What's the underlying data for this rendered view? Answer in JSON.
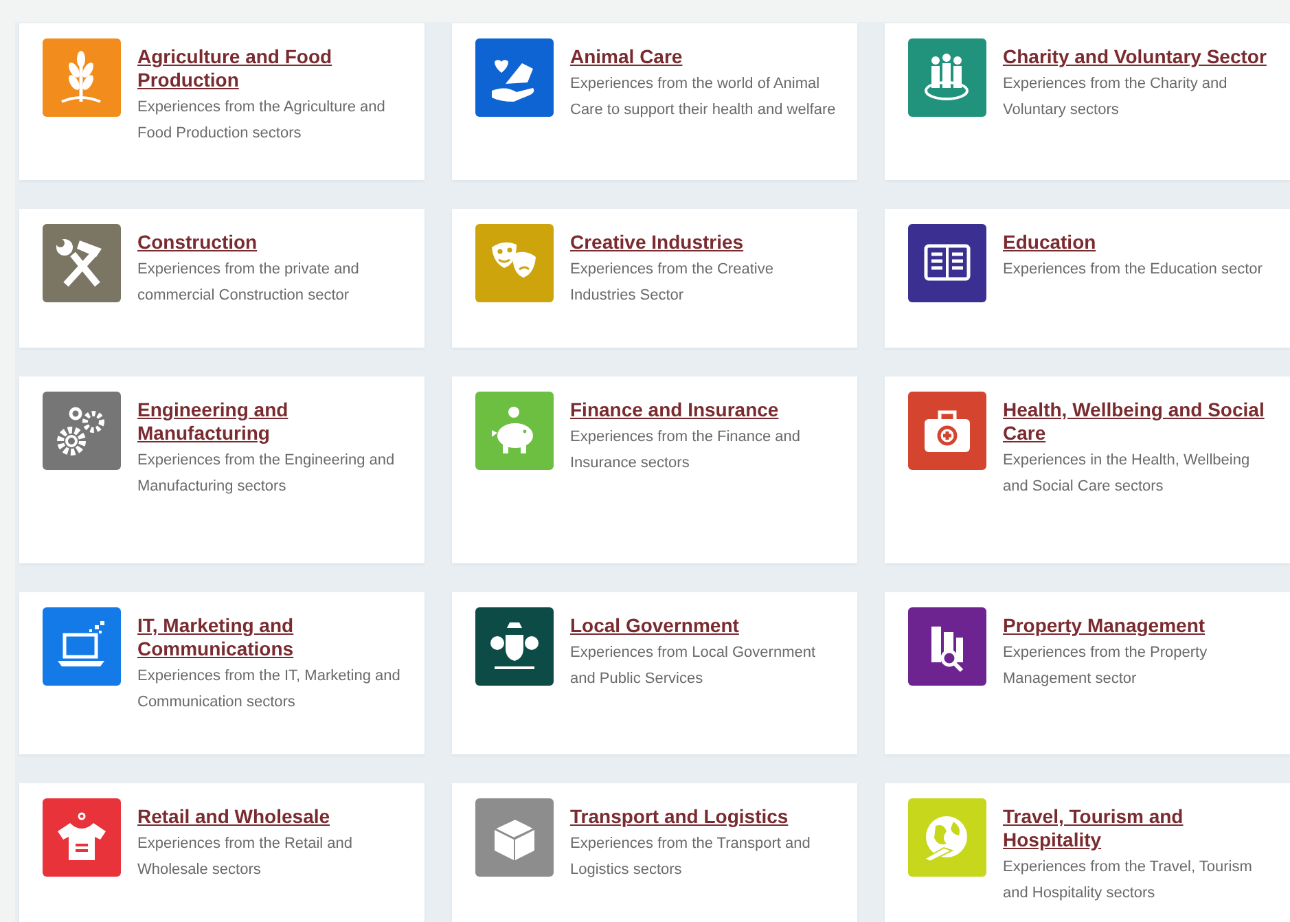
{
  "cards": [
    {
      "title": "Agriculture and Food Production",
      "description": "Experiences from the Agriculture and Food Production sectors",
      "color": "#f28c1c"
    },
    {
      "title": "Animal Care",
      "description": "Experiences from the world of Animal Care to support their health and welfare",
      "color": "#0e64d2"
    },
    {
      "title": "Charity and Voluntary Sector",
      "description": "Experiences from the Charity and Voluntary sectors",
      "color": "#21927c"
    },
    {
      "title": "Construction",
      "description": "Experiences from the private and commercial Construction sector",
      "color": "#7b7563"
    },
    {
      "title": "Creative Industries",
      "description": "Experiences from the Creative Industries Sector",
      "color": "#cda40c"
    },
    {
      "title": "Education",
      "description": "Experiences from the Education sector",
      "color": "#3b3091"
    },
    {
      "title": "Engineering and Manufacturing",
      "description": "Experiences from the Engineering and Manufacturing sectors",
      "color": "#767676"
    },
    {
      "title": "Finance and Insurance",
      "description": "Experiences from the Finance and Insurance sectors",
      "color": "#6cbf40"
    },
    {
      "title": "Health, Wellbeing and Social Care",
      "description": "Experiences in the Health, Wellbeing and Social Care sectors",
      "color": "#d4442f"
    },
    {
      "title": "IT, Marketing and Communications",
      "description": "Experiences from the IT, Marketing and Communication sectors",
      "color": "#137ae8"
    },
    {
      "title": "Local Government",
      "description": "Experiences from Local Government and Public Services",
      "color": "#0c4b46"
    },
    {
      "title": "Property Management",
      "description": "Experiences from the Property Management sector",
      "color": "#6d2491"
    },
    {
      "title": "Retail and Wholesale",
      "description": "Experiences from the Retail and Wholesale sectors",
      "color": "#e8333b"
    },
    {
      "title": "Transport and Logistics",
      "description": "Experiences from the Transport and Logistics sectors",
      "color": "#8d8d8d"
    },
    {
      "title": "Travel, Tourism and Hospitality",
      "description": "Experiences from the Travel, Tourism and Hospitality sectors",
      "color": "#c6d71c"
    }
  ]
}
